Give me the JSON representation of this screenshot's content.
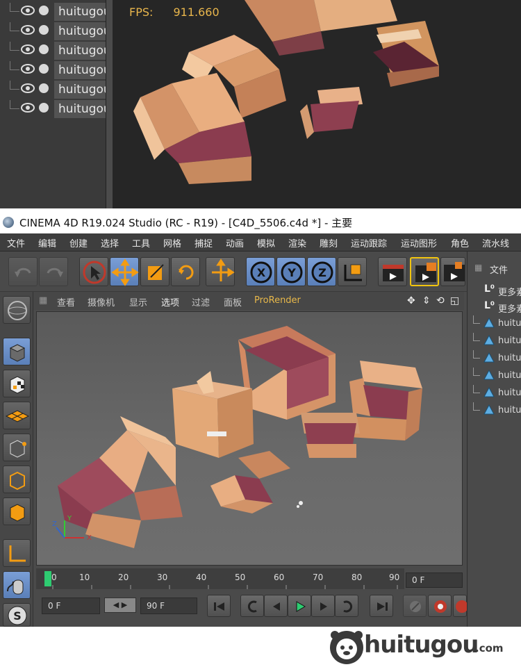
{
  "top_preview": {
    "fps_label": "FPS:",
    "fps_value": "911.660",
    "objects": [
      {
        "name": "huitugou"
      },
      {
        "name": "huitugou"
      },
      {
        "name": "huitugou"
      },
      {
        "name": "huitugou"
      },
      {
        "name": "huitugou"
      },
      {
        "name": "huitugou"
      }
    ]
  },
  "window": {
    "title": "CINEMA 4D R19.024 Studio (RC - R19) - [C4D_5506.c4d *] - 主要"
  },
  "menubar": {
    "items": [
      "文件",
      "编辑",
      "创建",
      "选择",
      "工具",
      "网格",
      "捕捉",
      "动画",
      "模拟",
      "渲染",
      "雕刻",
      "运动跟踪",
      "运动图形",
      "角色",
      "流水线"
    ]
  },
  "toolbar": {
    "axis_x": "X",
    "axis_y": "Y",
    "axis_z": "Z"
  },
  "viewport": {
    "menus": [
      "查看",
      "摄像机",
      "显示",
      "选项",
      "过滤",
      "面板",
      "ProRender"
    ],
    "prorender_color": "#e8b84a"
  },
  "timeline": {
    "ticks": [
      "0",
      "10",
      "20",
      "30",
      "40",
      "50",
      "60",
      "70",
      "80",
      "90"
    ],
    "current_frame": "0 F"
  },
  "transport": {
    "start_field": "0 F",
    "end_field": "90 F"
  },
  "object_manager": {
    "header": "文件",
    "items": [
      {
        "name": "更多素材",
        "type": "layer"
      },
      {
        "name": "更多素材",
        "type": "layer"
      },
      {
        "name": "huitugou",
        "type": "object"
      },
      {
        "name": "huitugou",
        "type": "object"
      },
      {
        "name": "huitugou",
        "type": "object"
      },
      {
        "name": "huitugou",
        "type": "object"
      },
      {
        "name": "huitugou",
        "type": "object"
      },
      {
        "name": "huitugou",
        "type": "object"
      }
    ]
  },
  "watermark": {
    "brand": "huitugou",
    "tld": ".com"
  },
  "colors": {
    "accent_blue": "#5a7fb8",
    "fps_text": "#e9b64c",
    "box_light": "#e7a66a",
    "box_dark": "#8b3c4f"
  }
}
